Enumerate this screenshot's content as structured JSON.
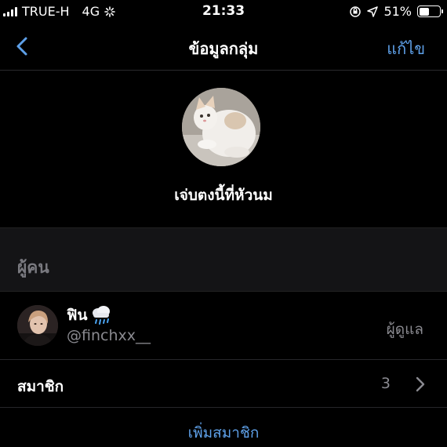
{
  "status_bar": {
    "carrier": "TRUE-H",
    "network": "4G",
    "time": "21:33",
    "battery_percent": "51%",
    "battery_level": 0.51
  },
  "nav": {
    "title": "ข้อมูลกลุ่ม",
    "edit_label": "แก้ไข"
  },
  "group": {
    "name": "เจ่บตงนี้ที่หัวนม"
  },
  "people_section": {
    "title": "ผู้คน"
  },
  "admin": {
    "name": "ฟิน",
    "handle": "@finchxx__",
    "role": "ผู้ดูแล"
  },
  "members": {
    "label": "สมาชิก",
    "count": "3"
  },
  "add_member_label": "เพิ่มสมาชิก",
  "colors": {
    "accent": "#5ea0e8",
    "background": "#000000",
    "section_bg": "#141416",
    "secondary_text": "#8a8a90"
  }
}
